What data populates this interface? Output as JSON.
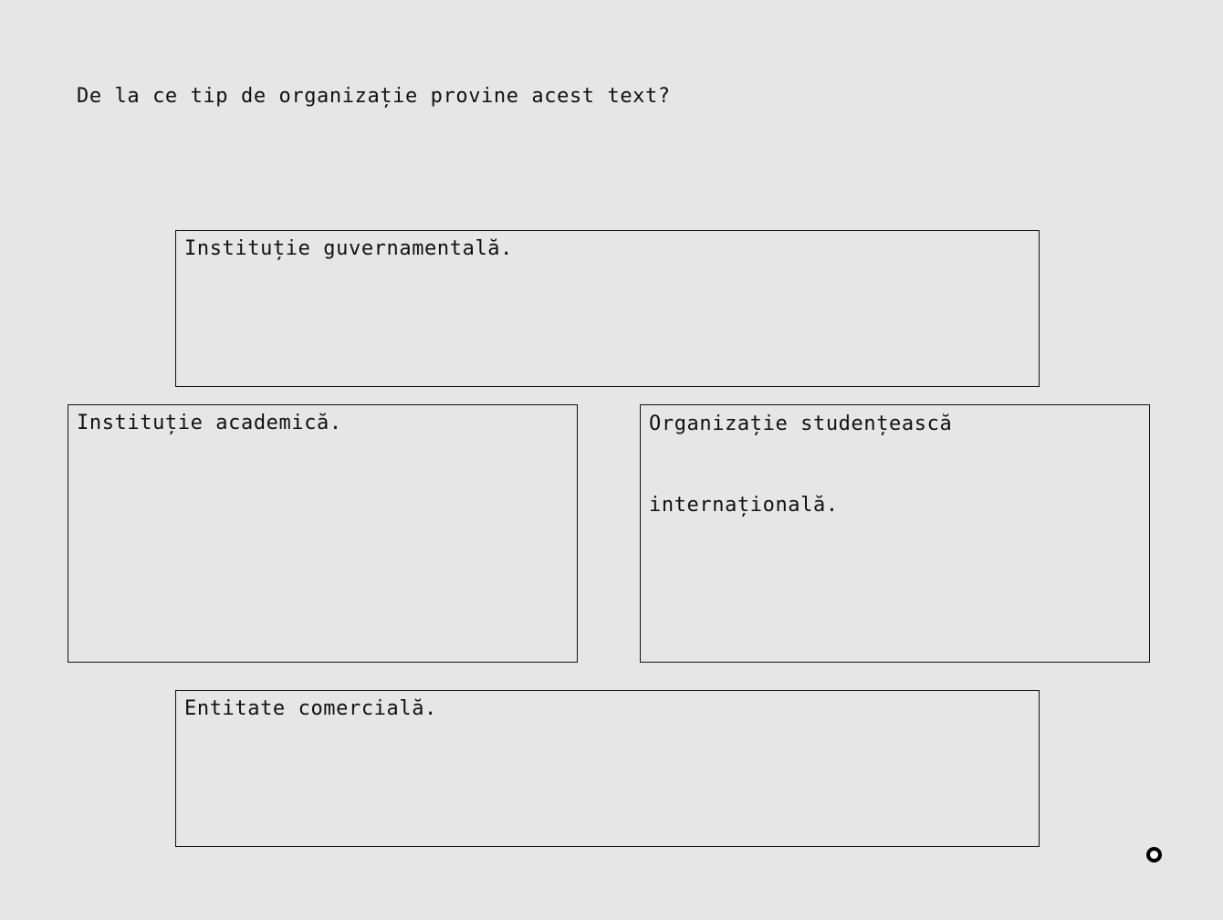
{
  "question": "De la ce tip de organizație provine acest text?",
  "options": [
    {
      "label": "Instituție guvernamentală."
    },
    {
      "label": "Instituție academică."
    },
    {
      "label": "Organizație studențească internațională."
    },
    {
      "label": "Entitate comercială."
    }
  ],
  "icons": {
    "cursor": "circle-cursor-icon"
  },
  "colors": {
    "background": "#e6e6e6",
    "border": "#111111",
    "text": "#111111"
  }
}
